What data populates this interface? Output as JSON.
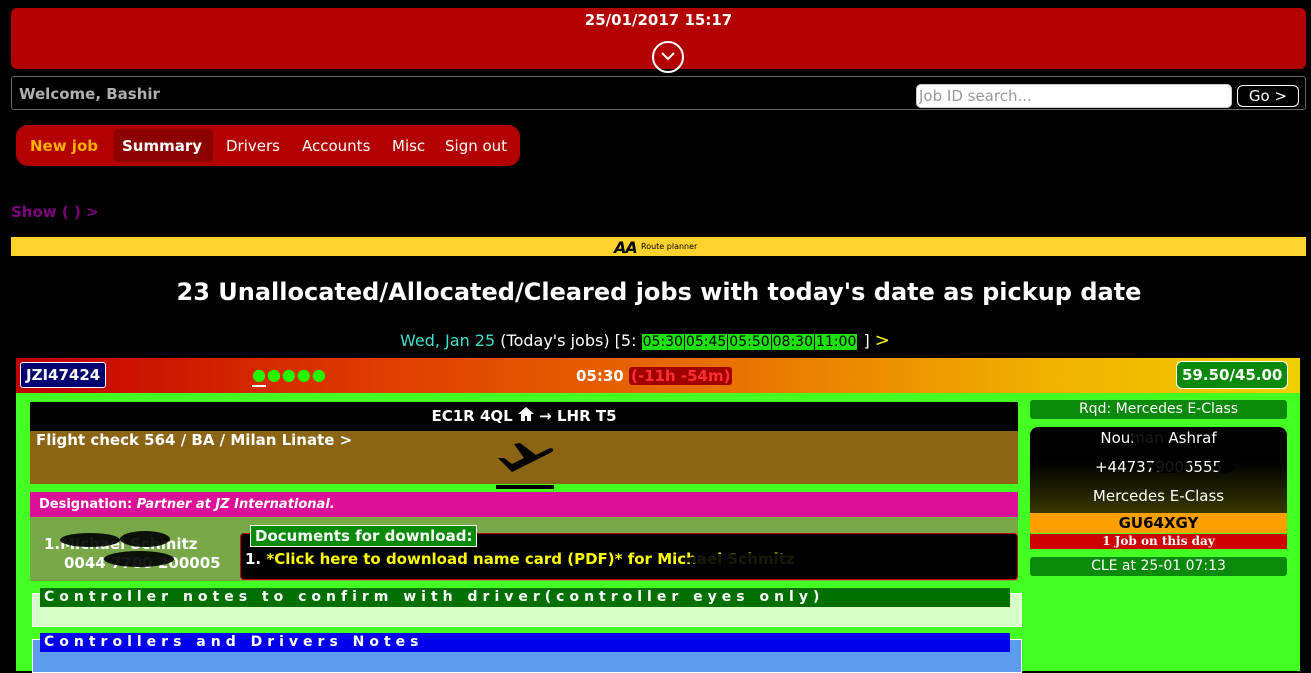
{
  "header": {
    "datetime": "25/01/2017 15:17"
  },
  "welcome": {
    "text": "Welcome, Bashir"
  },
  "search": {
    "placeholder": "Job ID search...",
    "go_label": "Go >"
  },
  "nav": {
    "new_job": "New job",
    "summary": "Summary",
    "drivers": "Drivers",
    "accounts": "Accounts",
    "misc": "Misc",
    "sign_out": "Sign out"
  },
  "show": {
    "label": "Show ( ) >"
  },
  "aa": {
    "logo": "AA",
    "label": "Route planner"
  },
  "main": {
    "heading": "23 Unallocated/Allocated/Cleared jobs with today's date as pickup date",
    "day_date": "Wed, Jan 25",
    "day_suffix": "(Today's jobs) [5:",
    "times": [
      "05:30",
      "05:45",
      "05:50",
      "08:30",
      "11:00"
    ],
    "times_close": "]",
    "next_arrow": ">"
  },
  "job": {
    "id": "JZI47424",
    "dots": "●●●●●",
    "time": "05:30",
    "late": "(-11h -54m)",
    "price": "59.50/45.00",
    "route_from": "EC1R 4QL",
    "route_to": "→ LHR T5",
    "flight": "Flight check 564 / BA / Milan Linate >",
    "designation_label": "Designation:",
    "designation_value": "Partner at JZ International.",
    "passenger_name": "1.Michael Schmitz",
    "passenger_phone": "0044 7700 200005",
    "documents_title": "Documents for download:",
    "doc_number": "1.",
    "doc_link": "*Click here to download name card (PDF)* for",
    "doc_name": "Michael Schmitz",
    "controller_notes": "Controller notes to confirm with driver(controller eyes only)",
    "driver_notes": "Controllers and Drivers Notes",
    "required": "Rqd: Mercedes E-Class",
    "driver_name": "Nouman Ashraf",
    "driver_phone": "+447379006555",
    "driver_car": "Mercedes E-Class",
    "registration": "GU64XGY",
    "jobs_today": "1 Job on this day",
    "cleared": "CLE at 25-01 07:13"
  },
  "colors": {
    "header_red": "#b30000",
    "time_green": "#1fe00f",
    "body_green": "#44ff22",
    "aa_yellow": "#ffd22e"
  },
  "icons": [
    "chevron-down-icon",
    "home-icon",
    "plane-departure-icon"
  ]
}
